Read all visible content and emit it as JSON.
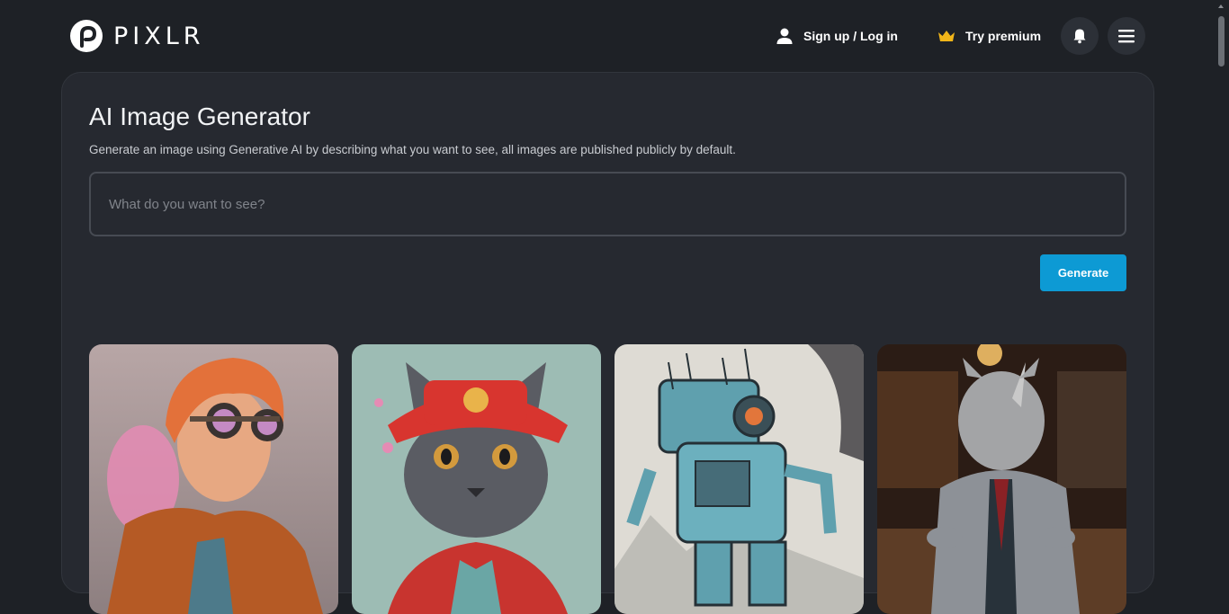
{
  "header": {
    "logo_text": "PIXLR",
    "signin_label": "Sign up / Log in",
    "premium_label": "Try premium",
    "accent_color": "#0d9ad4",
    "premium_icon_color": "#f2b619"
  },
  "main": {
    "title": "AI Image Generator",
    "subtitle": "Generate an image using Generative AI by describing what you want to see, all images are published publicly by default.",
    "prompt_placeholder": "What do you want to see?",
    "prompt_value": "",
    "generate_label": "Generate"
  },
  "gallery": {
    "items": [
      {
        "subject": "steampunk-boy-with-goggles"
      },
      {
        "subject": "cat-in-red-hat"
      },
      {
        "subject": "blue-robot-sketch"
      },
      {
        "subject": "rhino-in-suit"
      }
    ]
  },
  "icons": {
    "user": "user-icon",
    "crown": "crown-icon",
    "bell": "bell-icon",
    "menu": "hamburger-menu-icon"
  }
}
